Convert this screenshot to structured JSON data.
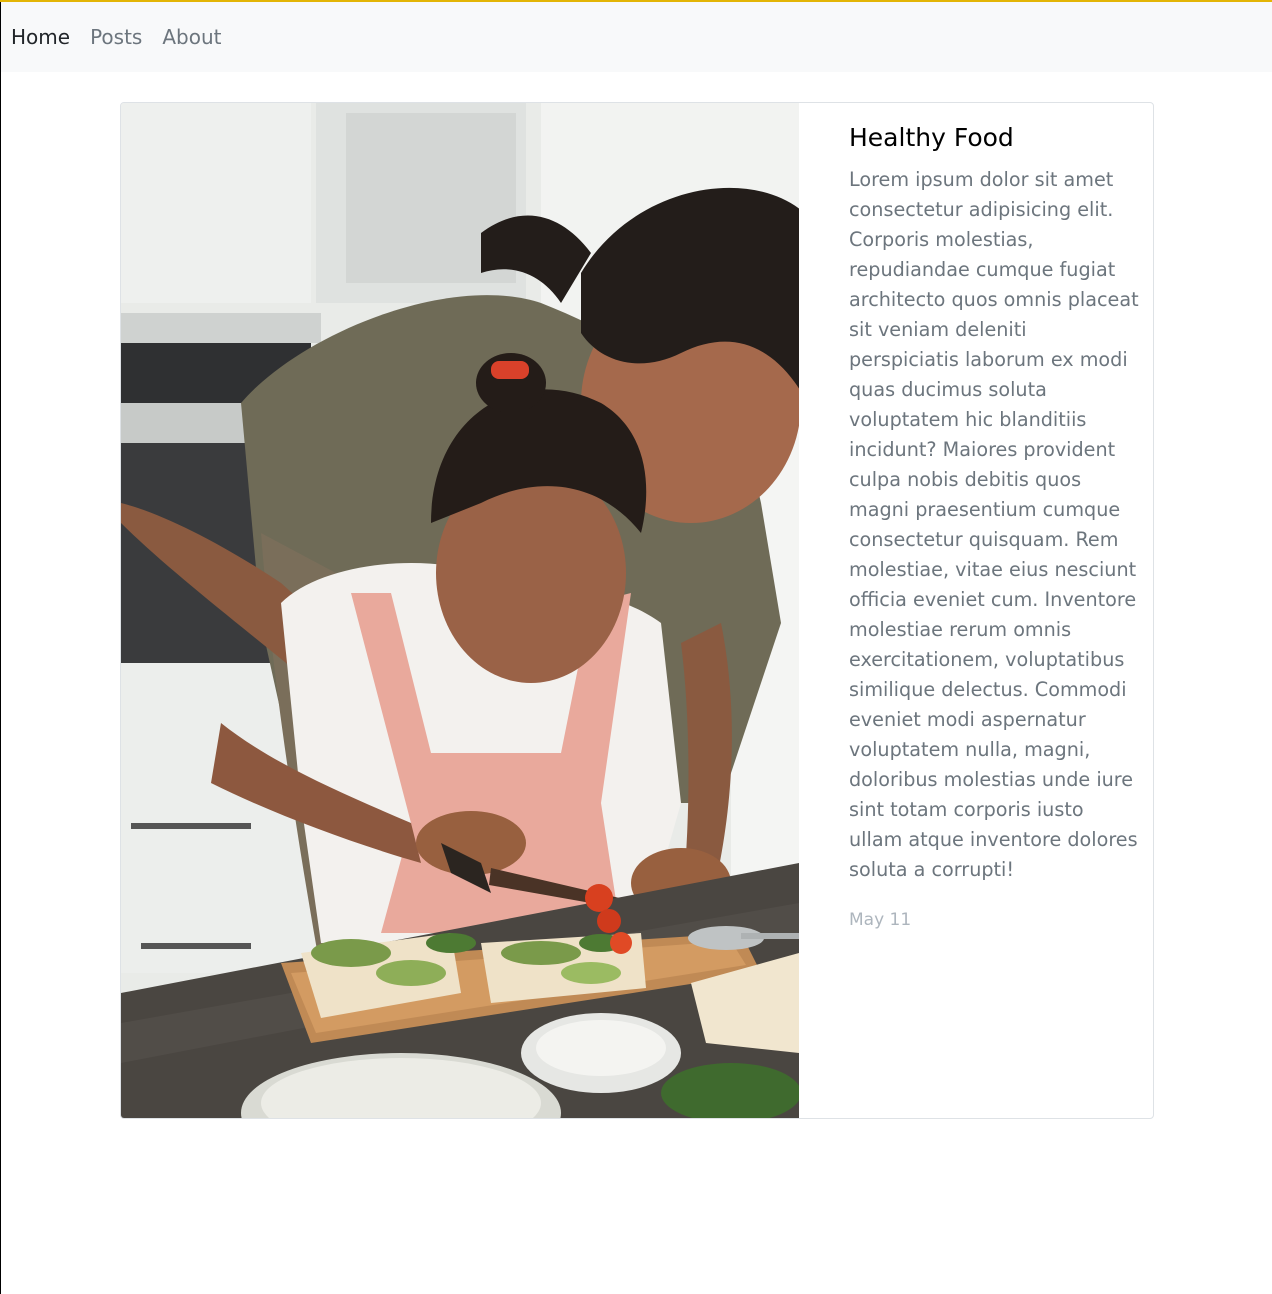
{
  "nav": {
    "items": [
      {
        "label": "Home",
        "active": true
      },
      {
        "label": "Posts",
        "active": false
      },
      {
        "label": "About",
        "active": false
      }
    ]
  },
  "post": {
    "title": "Healthy Food",
    "body": "Lorem ipsum dolor sit amet consectetur adipisicing elit. Corporis molestias, repudiandae cumque fugiat architecto quos omnis placeat sit veniam deleniti perspiciatis laborum ex modi quas ducimus soluta voluptatem hic blanditiis incidunt? Maiores provident culpa nobis debitis quos magni praesentium cumque consectetur quisquam. Rem molestiae, vitae eius nesciunt officia eveniet cum. Inventore molestiae rerum omnis exercitationem, voluptatibus similique delectus. Commodi eveniet modi aspernatur voluptatem nulla, magni, doloribus molestias unde iure sint totam corporis iusto ullam atque inventore dolores soluta a corrupti!",
    "date": "May 11"
  },
  "colors": {
    "accent_line": "#e3b505",
    "navbar_bg": "#f8f9fa",
    "muted_text": "#6c757d",
    "date_text": "#adb5bd"
  }
}
